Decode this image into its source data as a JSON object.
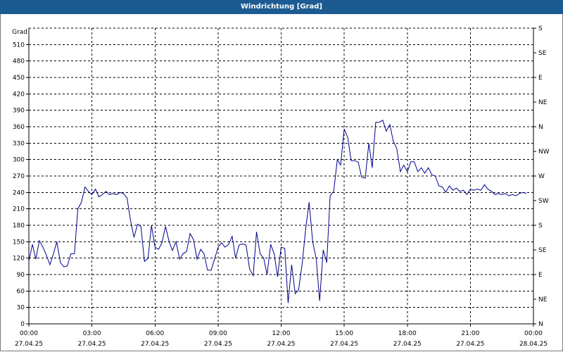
{
  "window": {
    "title": "Windrichtung [Grad]"
  },
  "chart_data": {
    "type": "line",
    "title": "Windrichtung [Grad]",
    "ylabel": "Grad",
    "ylim": [
      0,
      540
    ],
    "y_ticks": [
      0,
      30,
      60,
      90,
      120,
      150,
      180,
      210,
      240,
      270,
      300,
      330,
      360,
      390,
      420,
      450,
      480,
      510
    ],
    "right_axis_ticks": [
      "N",
      "NE",
      "E",
      "SE",
      "S",
      "SW",
      "W",
      "NW",
      "N",
      "NE",
      "E",
      "SE",
      "S"
    ],
    "x_ticks": [
      {
        "time": "00:00",
        "date": "27.04.25"
      },
      {
        "time": "03:00",
        "date": "27.04.25"
      },
      {
        "time": "06:00",
        "date": "27.04.25"
      },
      {
        "time": "09:00",
        "date": "27.04.25"
      },
      {
        "time": "12:00",
        "date": "27.04.25"
      },
      {
        "time": "15:00",
        "date": "27.04.25"
      },
      {
        "time": "18:00",
        "date": "27.04.25"
      },
      {
        "time": "21:00",
        "date": "27.04.25"
      },
      {
        "time": "00:00",
        "date": "28.04.25"
      }
    ],
    "grid": true,
    "line_color": "#00008b",
    "series": [
      {
        "x_hours": [
          0.0,
          0.17,
          0.33,
          0.5,
          0.67,
          0.83,
          1.0,
          1.17,
          1.33,
          1.5,
          1.67,
          1.83,
          2.0,
          2.17,
          2.33,
          2.5,
          2.67,
          2.83,
          3.0,
          3.17,
          3.33,
          3.5,
          3.67,
          3.83,
          4.0,
          4.17,
          4.33,
          4.5,
          4.67,
          4.83,
          5.0,
          5.17,
          5.33,
          5.5,
          5.67,
          5.83,
          6.0,
          6.17,
          6.33,
          6.5,
          6.67,
          6.83,
          7.0,
          7.17,
          7.33,
          7.5,
          7.67,
          7.83,
          8.0,
          8.17,
          8.33,
          8.5,
          8.67,
          8.83,
          9.0,
          9.17,
          9.33,
          9.5,
          9.67,
          9.83,
          10.0,
          10.17,
          10.33,
          10.5,
          10.67,
          10.83,
          11.0,
          11.17,
          11.33,
          11.5,
          11.67,
          11.83,
          12.0,
          12.17,
          12.33,
          12.5,
          12.67,
          12.83,
          13.0,
          13.17,
          13.33,
          13.5,
          13.67,
          13.83,
          14.0,
          14.17,
          14.33,
          14.5,
          14.67,
          14.83,
          15.0,
          15.17,
          15.33,
          15.5,
          15.67,
          15.83,
          16.0,
          16.17,
          16.33,
          16.5,
          16.67,
          16.83,
          17.0,
          17.17,
          17.33,
          17.5,
          17.67,
          17.83,
          18.0,
          18.17,
          18.33,
          18.5,
          18.67,
          18.83,
          19.0,
          19.17,
          19.33,
          19.5,
          19.67,
          19.83,
          20.0,
          20.17,
          20.33,
          20.5,
          20.67,
          20.83,
          21.0,
          21.17,
          21.33,
          21.5,
          21.67,
          21.83,
          22.0,
          22.17,
          22.33,
          22.5,
          22.67,
          22.83,
          23.0,
          23.17,
          23.33,
          23.5,
          23.67,
          23.83,
          24.0
        ],
        "values": [
          115,
          145,
          118,
          152,
          140,
          126,
          108,
          128,
          150,
          112,
          104,
          106,
          128,
          128,
          210,
          222,
          250,
          242,
          236,
          246,
          232,
          236,
          242,
          236,
          238,
          236,
          240,
          238,
          230,
          190,
          158,
          182,
          178,
          114,
          120,
          180,
          140,
          136,
          148,
          178,
          150,
          134,
          150,
          118,
          128,
          132,
          165,
          154,
          118,
          136,
          128,
          98,
          98,
          118,
          140,
          148,
          140,
          145,
          160,
          120,
          144,
          146,
          144,
          100,
          88,
          168,
          128,
          120,
          90,
          145,
          128,
          86,
          140,
          138,
          38,
          108,
          55,
          62,
          110,
          175,
          222,
          150,
          118,
          42,
          135,
          112,
          234,
          242,
          300,
          290,
          356,
          340,
          298,
          298,
          295,
          268,
          266,
          330,
          285,
          368,
          368,
          372,
          352,
          364,
          334,
          320,
          278,
          290,
          278,
          296,
          296,
          278,
          285,
          275,
          285,
          272,
          270,
          252,
          250,
          240,
          252,
          244,
          248,
          242,
          244,
          236,
          246,
          244,
          246,
          244,
          254,
          246,
          242,
          236,
          238,
          236,
          238,
          234,
          236,
          234,
          238,
          240,
          238
        ]
      }
    ]
  }
}
